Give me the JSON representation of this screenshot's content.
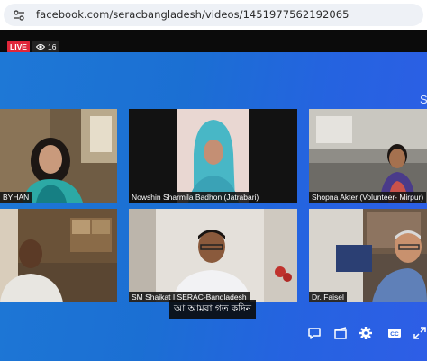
{
  "browser": {
    "url": "facebook.com/seracbangladesh/videos/1451977562192065",
    "site_icon": "site-settings-icon"
  },
  "stream": {
    "live_label": "LIVE",
    "viewer_count": "16",
    "corner_text": "S"
  },
  "participants": [
    {
      "name": "BYHAN"
    },
    {
      "name": "Nowshin Sharmila Badhon (Jatrabari)"
    },
    {
      "name": "Shopna Akter (Volunteer- Mirpur)"
    },
    {
      "name": ""
    },
    {
      "name": "SM Shaikat I SERAC-Bangladesh"
    },
    {
      "name": "Dr. Faisel"
    }
  ],
  "caption": "আ আমরা গত কদিন",
  "controls": [
    "comment-icon",
    "clip-icon",
    "settings-gear-icon",
    "closed-captions-icon",
    "fullscreen-icon"
  ],
  "colors": {
    "live": "#e0263a",
    "stage": "#1e78d6"
  }
}
